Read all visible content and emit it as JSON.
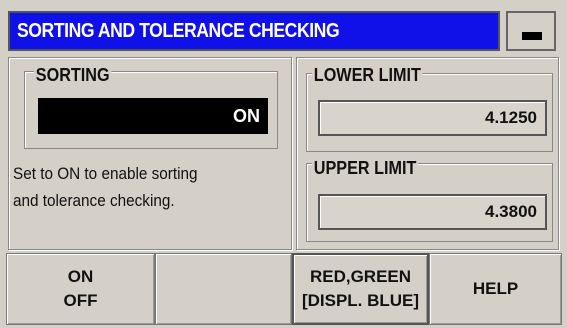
{
  "title": "SORTING AND TOLERANCE CHECKING",
  "title_bg": "#1010e8",
  "status_icon": "dash-icon",
  "sorting": {
    "label": "SORTING",
    "value": "ON"
  },
  "description": [
    "Set to ON to enable sorting",
    "and tolerance checking."
  ],
  "lower_limit": {
    "label": "LOWER LIMIT",
    "value": "4.1250"
  },
  "upper_limit": {
    "label": "UPPER LIMIT",
    "value": "4.3800"
  },
  "softkeys": [
    {
      "line1": "ON",
      "line2": "OFF"
    },
    {
      "line1": "",
      "line2": ""
    },
    {
      "line1": "RED,GREEN",
      "line2": "[DISPL. BLUE]"
    },
    {
      "line1": "HELP",
      "line2": ""
    }
  ]
}
